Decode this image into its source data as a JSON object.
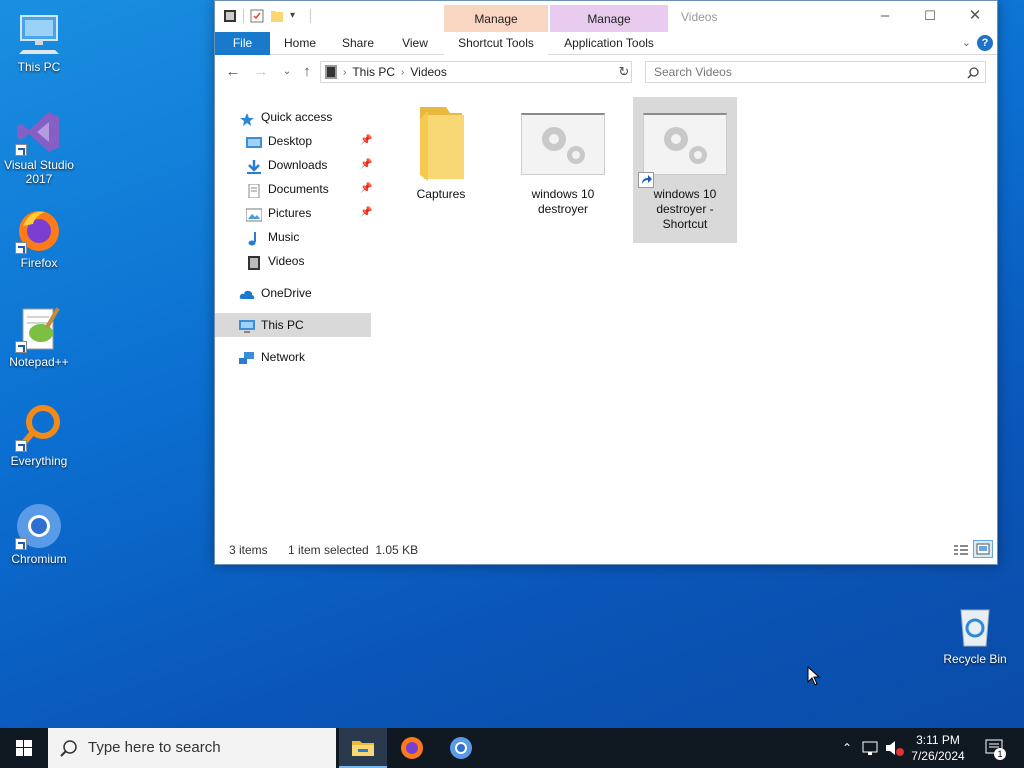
{
  "desktop": {
    "icons": [
      {
        "label": "This PC"
      },
      {
        "label": "Visual Studio 2017"
      },
      {
        "label": "Firefox"
      },
      {
        "label": "Notepad++"
      },
      {
        "label": "Everything"
      },
      {
        "label": "Chromium"
      },
      {
        "label": "Recycle Bin"
      }
    ]
  },
  "window": {
    "title": "Videos",
    "context_tabs": [
      {
        "label": "Manage",
        "color": "#f9d6c2"
      },
      {
        "label": "Manage",
        "color": "#e8cbee"
      }
    ],
    "ribbon_tabs": [
      "File",
      "Home",
      "Share",
      "View",
      "Shortcut Tools",
      "Application Tools"
    ],
    "help_label": "?",
    "address": {
      "crumbs": [
        "This PC",
        "Videos"
      ]
    },
    "search": {
      "placeholder": "Search Videos"
    },
    "nav": {
      "quick_access": "Quick access",
      "items": [
        {
          "label": "Desktop",
          "pinned": true
        },
        {
          "label": "Downloads",
          "pinned": true
        },
        {
          "label": "Documents",
          "pinned": true
        },
        {
          "label": "Pictures",
          "pinned": true
        },
        {
          "label": "Music",
          "pinned": false
        },
        {
          "label": "Videos",
          "pinned": false
        }
      ],
      "onedrive": "OneDrive",
      "this_pc": "This PC",
      "network": "Network"
    },
    "files": [
      {
        "name": "Captures",
        "type": "folder"
      },
      {
        "name": "windows 10 destroyer",
        "type": "application"
      },
      {
        "name": "windows 10 destroyer - Shortcut",
        "type": "shortcut",
        "selected": true
      }
    ],
    "status": {
      "count": "3 items",
      "selection": "1 item selected  1.05 KB"
    }
  },
  "taskbar": {
    "search_placeholder": "Type here to search",
    "apps": [
      "file-explorer-icon",
      "firefox-icon",
      "chromium-icon"
    ],
    "time": "3:11 PM",
    "date": "7/26/2024",
    "notification_count": "1"
  },
  "colors": {
    "accent": "#1979ca",
    "selection": "#d9d9d9",
    "taskbar": "#101821"
  }
}
